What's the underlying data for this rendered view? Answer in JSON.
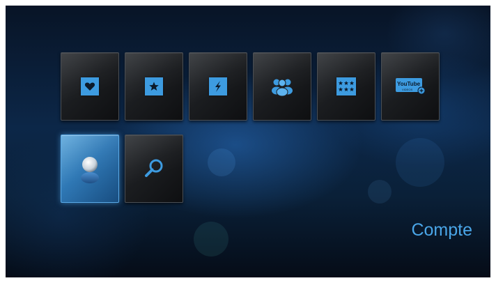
{
  "screen": {
    "label": "Compte",
    "tiles_row1": [
      {
        "name": "favorites",
        "icon": "heart-icon"
      },
      {
        "name": "starred",
        "icon": "star-icon"
      },
      {
        "name": "flash",
        "icon": "lightning-icon"
      },
      {
        "name": "community",
        "icon": "people-icon"
      },
      {
        "name": "ratings",
        "icon": "six-stars-icon"
      },
      {
        "name": "youtube",
        "icon": "youtube-videos-icon",
        "logo_text": "YouTube",
        "logo_sub": "VIDEOS"
      }
    ],
    "tiles_row2": [
      {
        "name": "account",
        "icon": "user-icon",
        "selected": true
      },
      {
        "name": "search",
        "icon": "magnifier-icon"
      }
    ]
  },
  "colors": {
    "accent": "#3d9be0",
    "label": "#4aa6e8",
    "selected_tile": "#2f78b5"
  }
}
